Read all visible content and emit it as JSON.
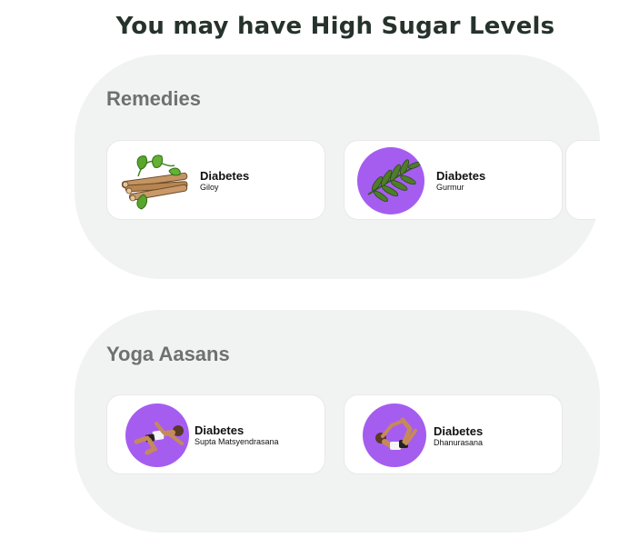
{
  "page": {
    "title": "You may have High Sugar Levels"
  },
  "remedies": {
    "title": "Remedies",
    "cards": [
      {
        "title": "Diabetes",
        "subtitle": "Giloy",
        "icon": "giloy-stem-icon"
      },
      {
        "title": "Diabetes",
        "subtitle": "Gurmur",
        "icon": "gurmur-leaf-icon"
      }
    ]
  },
  "yoga": {
    "title": "Yoga Aasans",
    "cards": [
      {
        "title": "Diabetes",
        "subtitle": "Supta Matsyendrasana",
        "icon": "supta-matsyendrasana-pose-icon"
      },
      {
        "title": "Diabetes",
        "subtitle": "Dhanurasana",
        "icon": "dhanurasana-pose-icon"
      }
    ]
  },
  "colors": {
    "title": "#26332c",
    "section_bg": "#f1f3f2",
    "section_heading": "#707070",
    "card_bg": "#ffffff",
    "icon_circle": "#a55df0"
  }
}
